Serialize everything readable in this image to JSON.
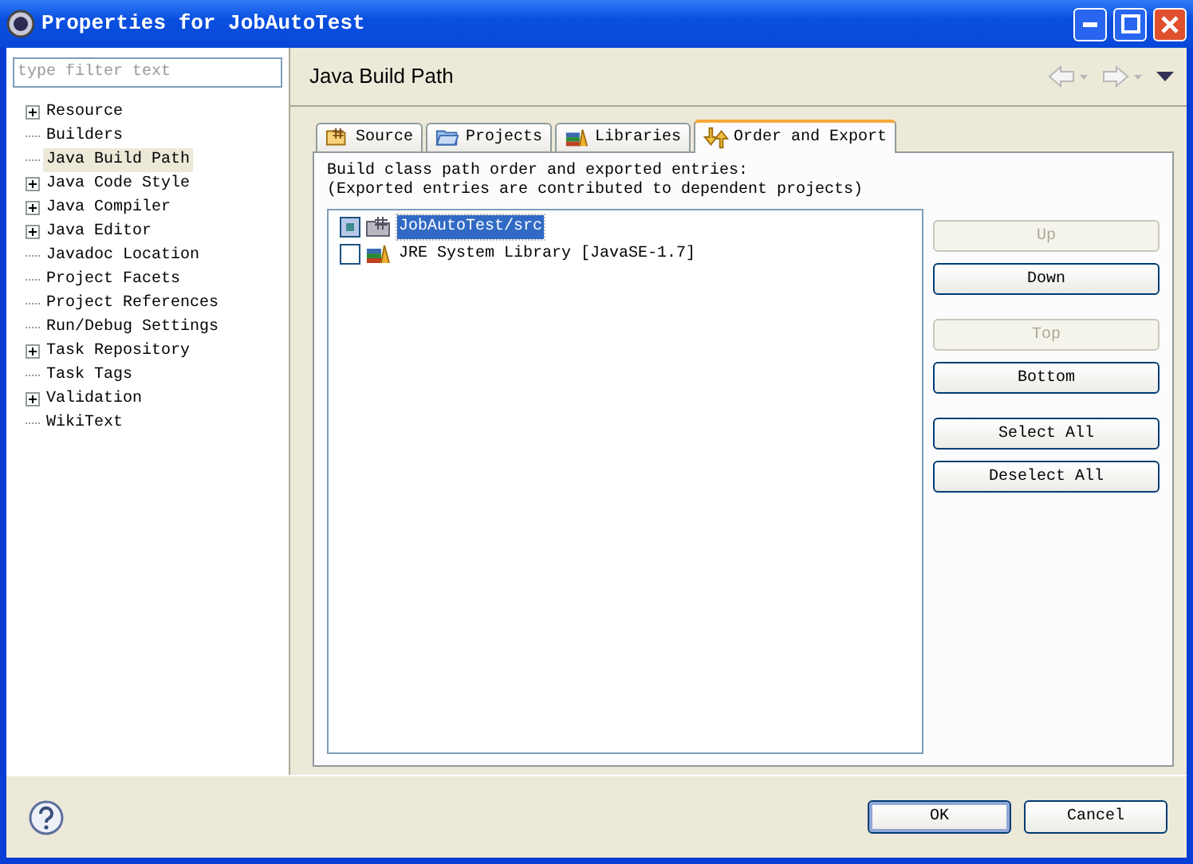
{
  "window": {
    "title": "Properties for JobAutoTest"
  },
  "filter": {
    "placeholder": "type filter text"
  },
  "tree": [
    {
      "label": "Resource",
      "expanded": false,
      "selected": false
    },
    {
      "label": "Builders",
      "selected": false
    },
    {
      "label": "Java Build Path",
      "selected": true
    },
    {
      "label": "Java Code Style",
      "expanded": false,
      "selected": false
    },
    {
      "label": "Java Compiler",
      "expanded": false,
      "selected": false
    },
    {
      "label": "Java Editor",
      "expanded": false,
      "selected": false
    },
    {
      "label": "Javadoc Location",
      "selected": false
    },
    {
      "label": "Project Facets",
      "selected": false
    },
    {
      "label": "Project References",
      "selected": false
    },
    {
      "label": "Run/Debug Settings",
      "selected": false
    },
    {
      "label": "Task Repository",
      "expanded": false,
      "selected": false
    },
    {
      "label": "Task Tags",
      "selected": false
    },
    {
      "label": "Validation",
      "expanded": false,
      "selected": false
    },
    {
      "label": "WikiText",
      "selected": false
    }
  ],
  "page_title": "Java Build Path",
  "tabs": [
    {
      "label": "Source",
      "kind": "source",
      "selected": false
    },
    {
      "label": "Projects",
      "kind": "projects",
      "selected": false
    },
    {
      "label": "Libraries",
      "kind": "libraries",
      "selected": false
    },
    {
      "label": "Order and Export",
      "kind": "order",
      "selected": true
    }
  ],
  "description": [
    "Build class path order and exported entries:",
    "(Exported entries are contributed to dependent projects)"
  ],
  "entries": [
    {
      "label": "JobAutoTest/src",
      "kind": "source",
      "checked": true,
      "selected": true
    },
    {
      "label": "JRE System Library [JavaSE-1.7]",
      "kind": "library",
      "checked": false,
      "selected": false
    }
  ],
  "side_buttons": [
    {
      "label": "Up",
      "disabled": true
    },
    {
      "label": "Down",
      "disabled": false
    },
    {
      "label": "Top",
      "disabled": true
    },
    {
      "label": "Bottom",
      "disabled": false
    },
    {
      "label": "Select All",
      "disabled": false
    },
    {
      "label": "Deselect All",
      "disabled": false
    }
  ],
  "buttons": [
    {
      "label": "OK",
      "default": true
    },
    {
      "label": "Cancel",
      "default": false
    }
  ]
}
